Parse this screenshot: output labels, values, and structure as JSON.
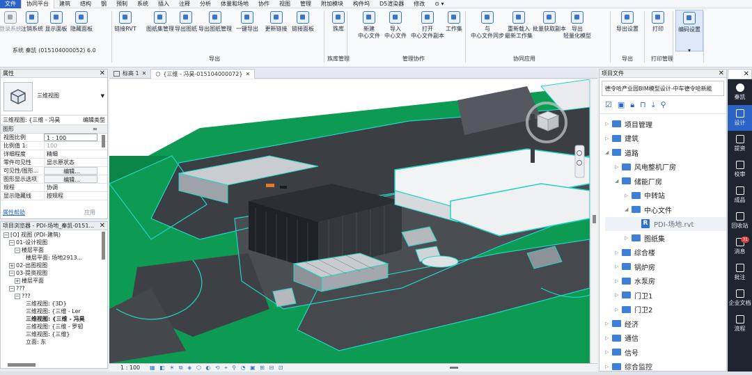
{
  "menu": [
    "文件",
    "协同平台",
    "建筑",
    "结构",
    "钢",
    "预制",
    "系统",
    "插入",
    "注释",
    "分析",
    "体量和场地",
    "协作",
    "视图",
    "管理",
    "附加模块",
    "构件坞",
    "D5渲染器",
    "修改"
  ],
  "ribbon": {
    "buttons": [
      "登录系统",
      "注销系统",
      "显示面板",
      "隐藏面板",
      "链接RVT",
      "图纸集管理",
      "导出图纸",
      "导出图纸管理",
      "一键导出",
      "更新链接",
      "链接面板",
      "族库",
      "新建\n中心文件",
      "导入\n中心文件",
      "打开\n中心文件副本",
      "工作集",
      "与\n中心文件同步",
      "重新载入\n最新工作集",
      "批量获取副本",
      "导出\n轻量化模型",
      "导出设置",
      "打印",
      "编码设置"
    ],
    "system_info": "系统 秦凯 (015104000052)  6.0",
    "groups": [
      "导出",
      "族库管理",
      "管理协作",
      "协同应用",
      "导出",
      "打印管理"
    ]
  },
  "properties": {
    "title": "属性",
    "type_name": "三维视图",
    "selector": "三维视图: {三维 - 冯昊",
    "edit_type": "编辑类型",
    "section": "图形",
    "rows": [
      {
        "k": "视图比例",
        "v": "1 : 100"
      },
      {
        "k": "比例值 1:",
        "v": "100"
      },
      {
        "k": "详细程度",
        "v": "精细"
      },
      {
        "k": "零件可见性",
        "v": "显示原状态"
      },
      {
        "k": "可见性/图形...",
        "v": "编辑..."
      },
      {
        "k": "图形显示选项",
        "v": "编辑..."
      },
      {
        "k": "规程",
        "v": "协调"
      },
      {
        "k": "显示隐藏线",
        "v": "按规程"
      }
    ],
    "help_link": "属性帮助",
    "apply": "应用"
  },
  "browser": {
    "title": "项目浏览器 - PDI-场地_秦凯-0151...",
    "items": [
      "[O] 视图 (PDI-建筑)",
      "01-设计视图",
      "楼层平面",
      "楼层平面: 场地2913...",
      "02-出图视图",
      "03-提资视图",
      "楼层平面",
      "???",
      "???",
      "三维视图: {3D}",
      "三维视图: {三维 - Ler",
      "三维视图: {三维 - 冯昊",
      "三维视图: {三维 - 罗韧",
      "三维视图: {三维}",
      "立面: 东"
    ]
  },
  "tabs": [
    "标高 1",
    "{三维 - 冯昊-015104000072}"
  ],
  "viewbar": {
    "scale": "1 : 100"
  },
  "project_files": {
    "title": "项目文件",
    "path": "德令哈产业园BIM模型设计-中车德令哈新能",
    "tree": [
      {
        "label": "项目管理",
        "level": 0
      },
      {
        "label": "建筑",
        "level": 0
      },
      {
        "label": "道路",
        "level": 0,
        "open": true
      },
      {
        "label": "风电整机厂房",
        "level": 1
      },
      {
        "label": "储能厂房",
        "level": 1,
        "open": true
      },
      {
        "label": "中转站",
        "level": 2
      },
      {
        "label": "中心文件",
        "level": 2,
        "open": true
      },
      {
        "label": "PDI-场地.rvt",
        "level": 3,
        "file": true
      },
      {
        "label": "图纸集",
        "level": 2
      },
      {
        "label": "综合楼",
        "level": 1
      },
      {
        "label": "锅炉房",
        "level": 1
      },
      {
        "label": "水泵房",
        "level": 1
      },
      {
        "label": "门卫1",
        "level": 1
      },
      {
        "label": "门卫2",
        "level": 1
      },
      {
        "label": "经济",
        "level": 0
      },
      {
        "label": "通信",
        "level": 0
      },
      {
        "label": "信号",
        "level": 0
      },
      {
        "label": "综合监控",
        "level": 0
      }
    ]
  },
  "sidebar": [
    {
      "label": "秦凯",
      "icon": "avatar"
    },
    {
      "label": "设计",
      "icon": "design-icon",
      "active": true
    },
    {
      "label": "提资",
      "icon": "submit-icon"
    },
    {
      "label": "校审",
      "icon": "review-icon"
    },
    {
      "label": "成品",
      "icon": "product-icon"
    },
    {
      "label": "回收站",
      "icon": "trash-icon"
    },
    {
      "label": "消息",
      "icon": "bell-icon",
      "badge": "31"
    },
    {
      "label": "批注",
      "icon": "annotate-icon"
    },
    {
      "label": "企业文档",
      "icon": "folder-icon"
    },
    {
      "label": "流程",
      "icon": "flow-icon"
    }
  ]
}
